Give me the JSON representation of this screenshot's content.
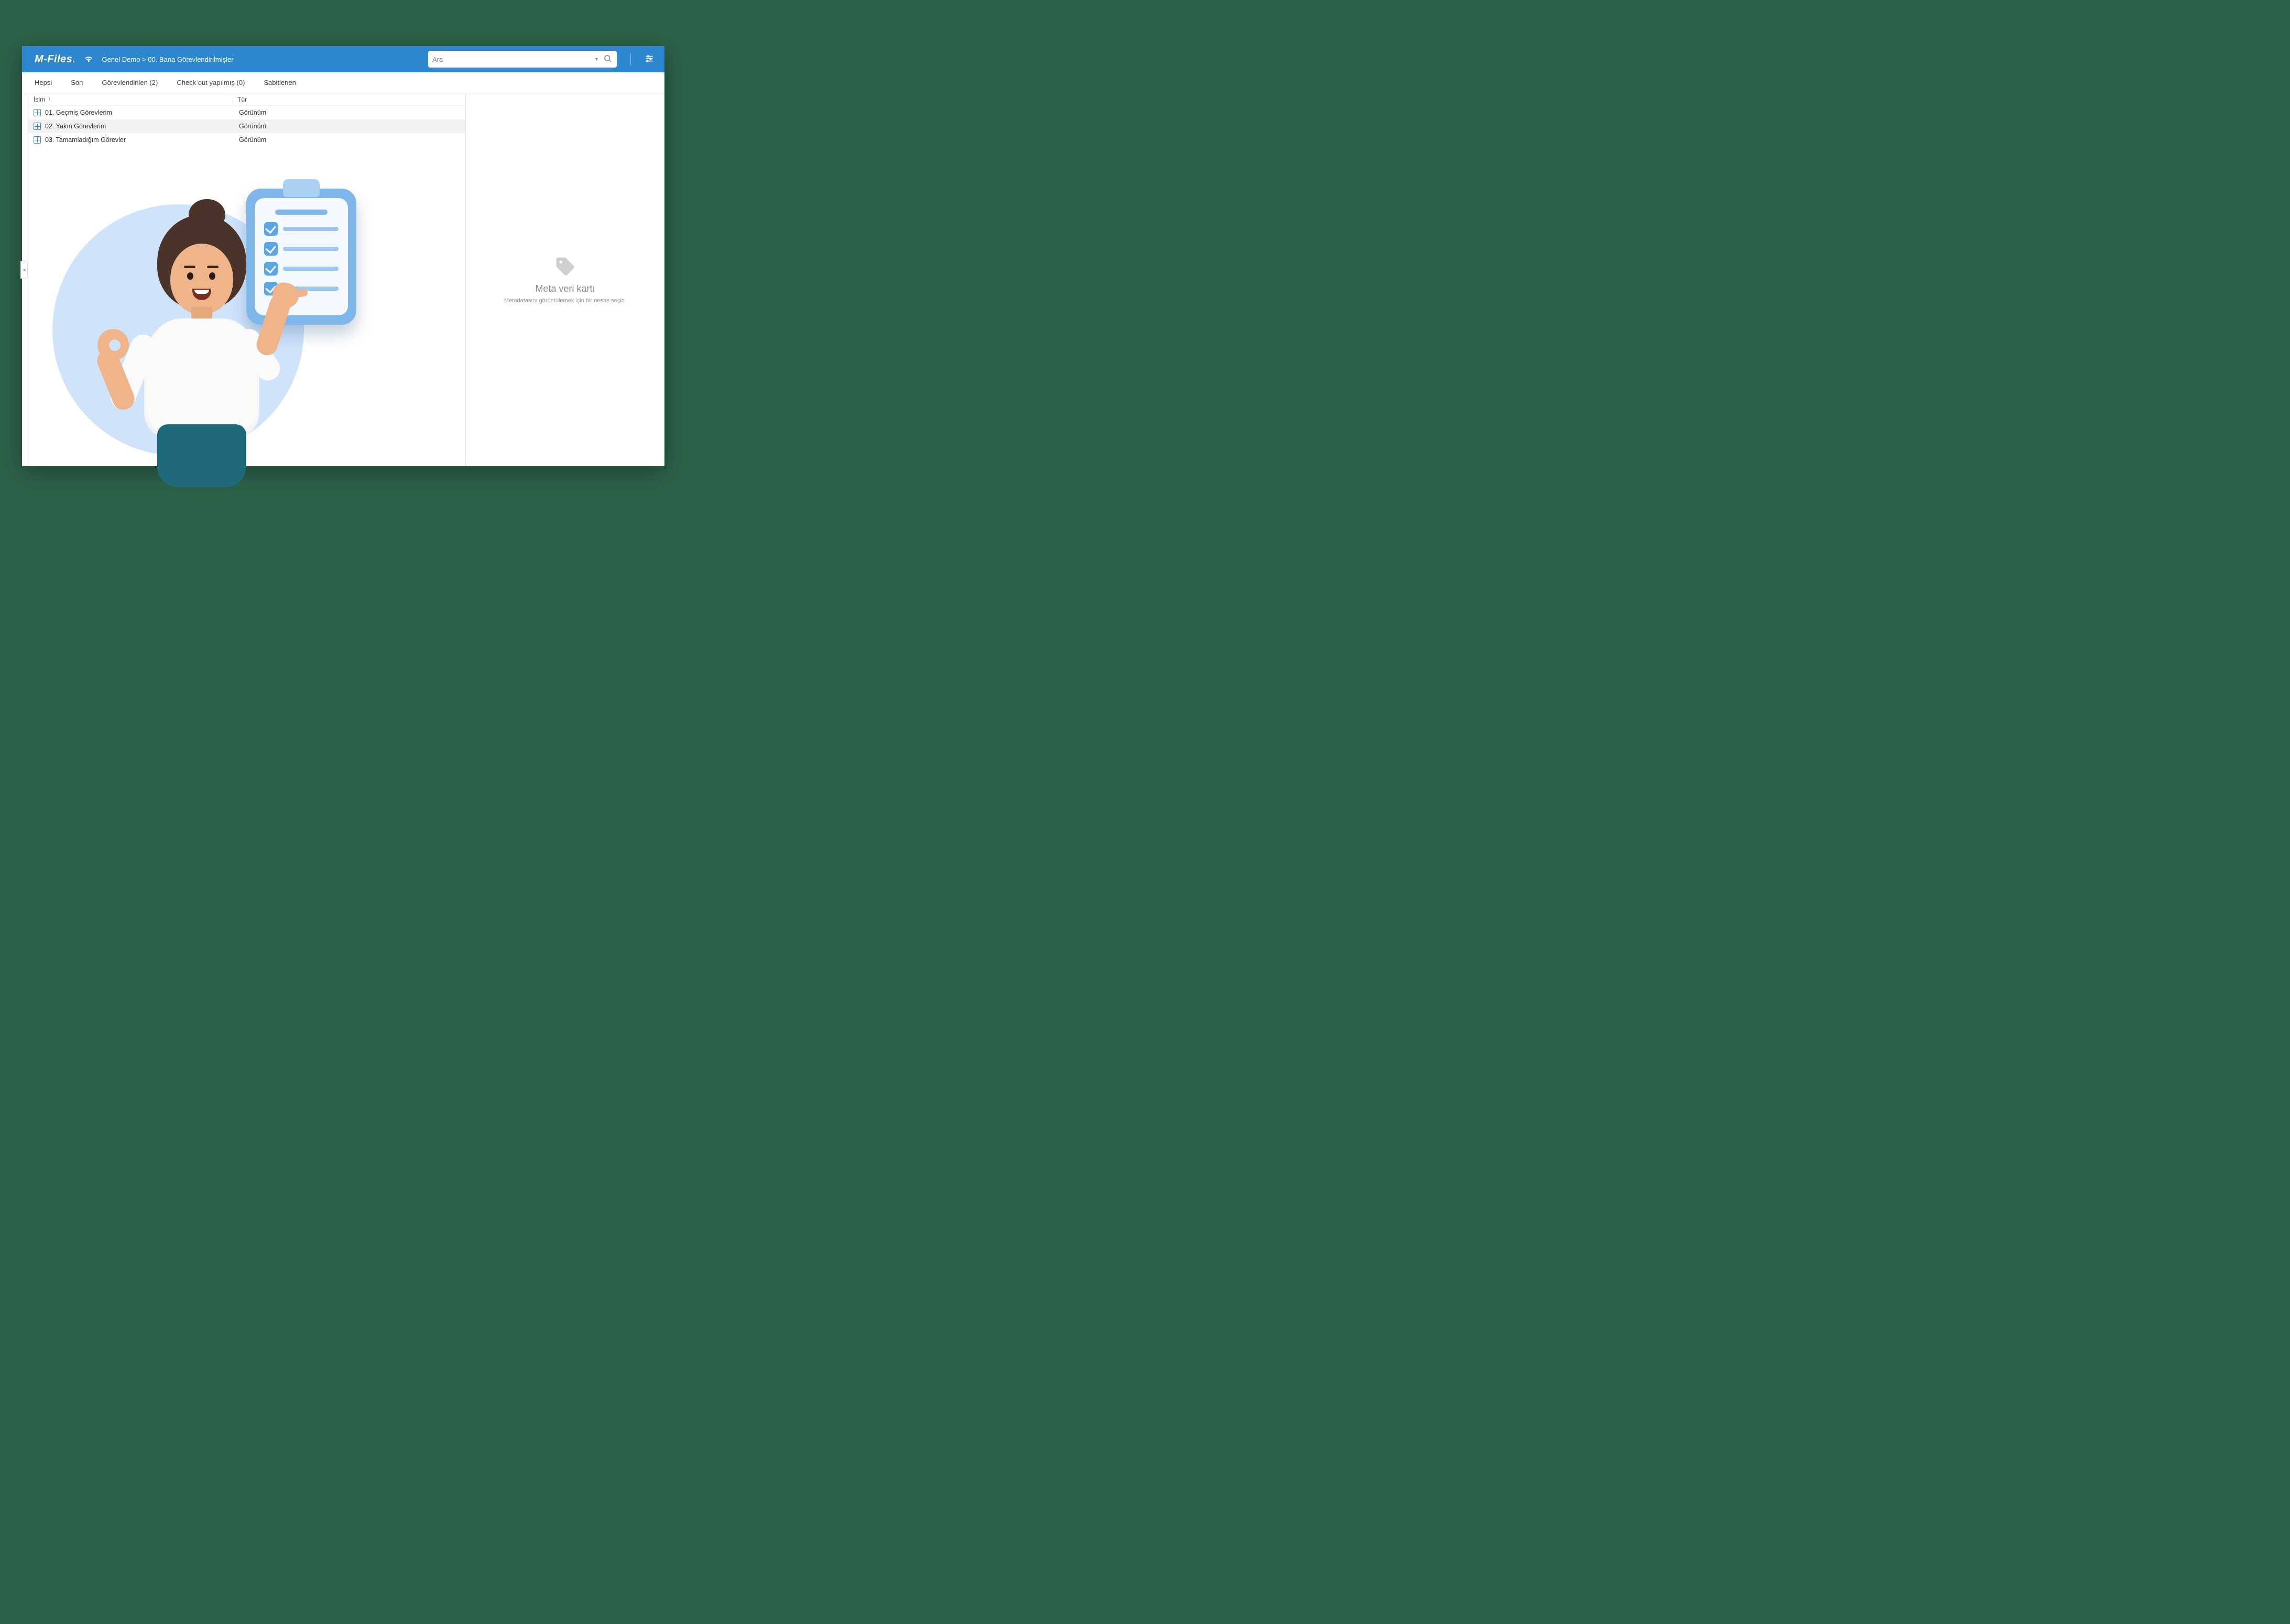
{
  "header": {
    "logo": "M-Files.",
    "breadcrumb": "Genel Demo > 00. Bana Görevlendirilmişler",
    "search_placeholder": "Ara"
  },
  "tabs": [
    {
      "label": "Hepsi"
    },
    {
      "label": "Son"
    },
    {
      "label": "Görevlendirilen (2)"
    },
    {
      "label": "Check out yapılmış (0)"
    },
    {
      "label": "Sabitlenen"
    }
  ],
  "columns": {
    "name": "İsim",
    "type": "Tür"
  },
  "rows": [
    {
      "name": "01. Geçmiş Görevlerim",
      "type": "Görünüm"
    },
    {
      "name": "02. Yakın Görevlerim",
      "type": "Görünüm"
    },
    {
      "name": "03. Tamamladığım Görevler",
      "type": "Görünüm"
    }
  ],
  "meta_panel": {
    "title": "Meta veri kartı",
    "subtitle": "Metadatasını görüntülemek için bir nesne seçin."
  }
}
